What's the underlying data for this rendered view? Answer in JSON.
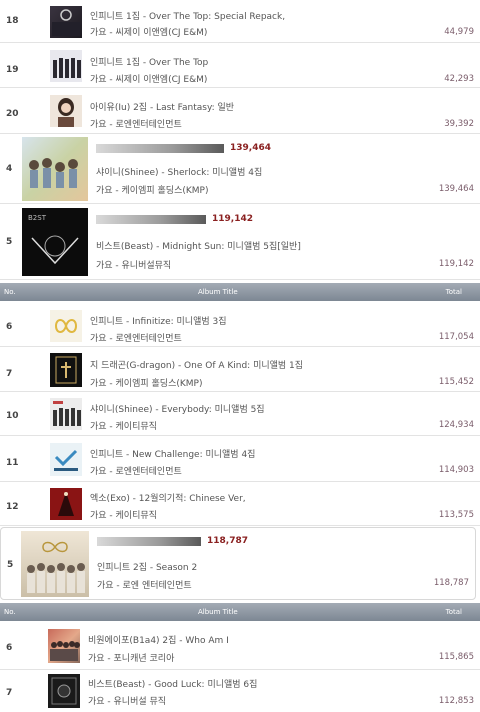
{
  "rows_top": [
    {
      "rank": "18",
      "title": "인피니트 1집 - Over The Top: Special Repack,",
      "sub": "가요 - 씨제이 이앤엠(CJ E&M)",
      "total": "44,979"
    },
    {
      "rank": "19",
      "title": "인피니트 1집 - Over The Top",
      "sub": "가요 - 씨제이 이앤엠(CJ E&M)",
      "total": "42,293"
    },
    {
      "rank": "20",
      "title": "아이유(Iu) 2집 - Last Fantasy: 일반",
      "sub": "가요 - 로엔엔터테인먼트",
      "total": "39,392"
    }
  ],
  "featured_top": [
    {
      "rank": "4",
      "bar_value": "139,464",
      "bar_fraction": 0.55,
      "title": "샤이니(Shinee) - Sherlock: 미니앨범 4집",
      "sub": "가요 - 케이엠피 홀딩스(KMP)",
      "total": "139,464"
    },
    {
      "rank": "5",
      "bar_value": "119,142",
      "bar_fraction": 0.47,
      "title": "비스트(Beast) - Midnight Sun: 미니앨범 5집[일반]",
      "sub": "가요 - 유니버설뮤직",
      "total": "119,142"
    }
  ],
  "header1": {
    "no": "No.",
    "album_title": "Album Title",
    "total": "Total"
  },
  "rows_mid": [
    {
      "rank": "6",
      "title": "인피니트 - Infinitize: 미니앨범 3집",
      "sub": "가요 - 로엔엔터테인먼트",
      "total": "117,054"
    },
    {
      "rank": "7",
      "title": "지 드래곤(G-dragon) - One Of A Kind: 미니앨범 1집",
      "sub": "가요 - 케이엠피 홀딩스(KMP)",
      "total": "115,452"
    },
    {
      "rank": "10",
      "title": "샤이니(Shinee) - Everybody: 미니앨범 5집",
      "sub": "가요 - 케이티뮤직",
      "total": "124,934"
    },
    {
      "rank": "11",
      "title": "인피니트 - New Challenge: 미니앨범 4집",
      "sub": "가요 - 로엔엔터테인먼트",
      "total": "114,903"
    },
    {
      "rank": "12",
      "title": "엑소(Exo) - 12월의기적: Chinese Ver,",
      "sub": "가요 - 케이티뮤직",
      "total": "113,575"
    }
  ],
  "featured_mid": {
    "rank": "5",
    "bar_value": "118,787",
    "bar_fraction": 0.52,
    "title": "인피니트 2집 - Season 2",
    "sub": "가요 - 로엔 엔터테인먼트",
    "total": "118,787"
  },
  "header2": {
    "no": "No.",
    "album_title": "Album Title",
    "total": "Total"
  },
  "rows_bottom": [
    {
      "rank": "6",
      "title": "비원에이포(B1a4) 2집 - Who Am I",
      "sub": "가요 - 포니캐년 코리아",
      "total": "115,865"
    },
    {
      "rank": "7",
      "title": "비스트(Beast) - Good Luck: 미니앨범 6집",
      "sub": "가요 - 유니버설 뮤직",
      "total": "112,853"
    }
  ],
  "colors": {
    "header_bg": "#8a939e",
    "total_text": "#7a5c6a",
    "bar_value_text": "#8a2020"
  }
}
